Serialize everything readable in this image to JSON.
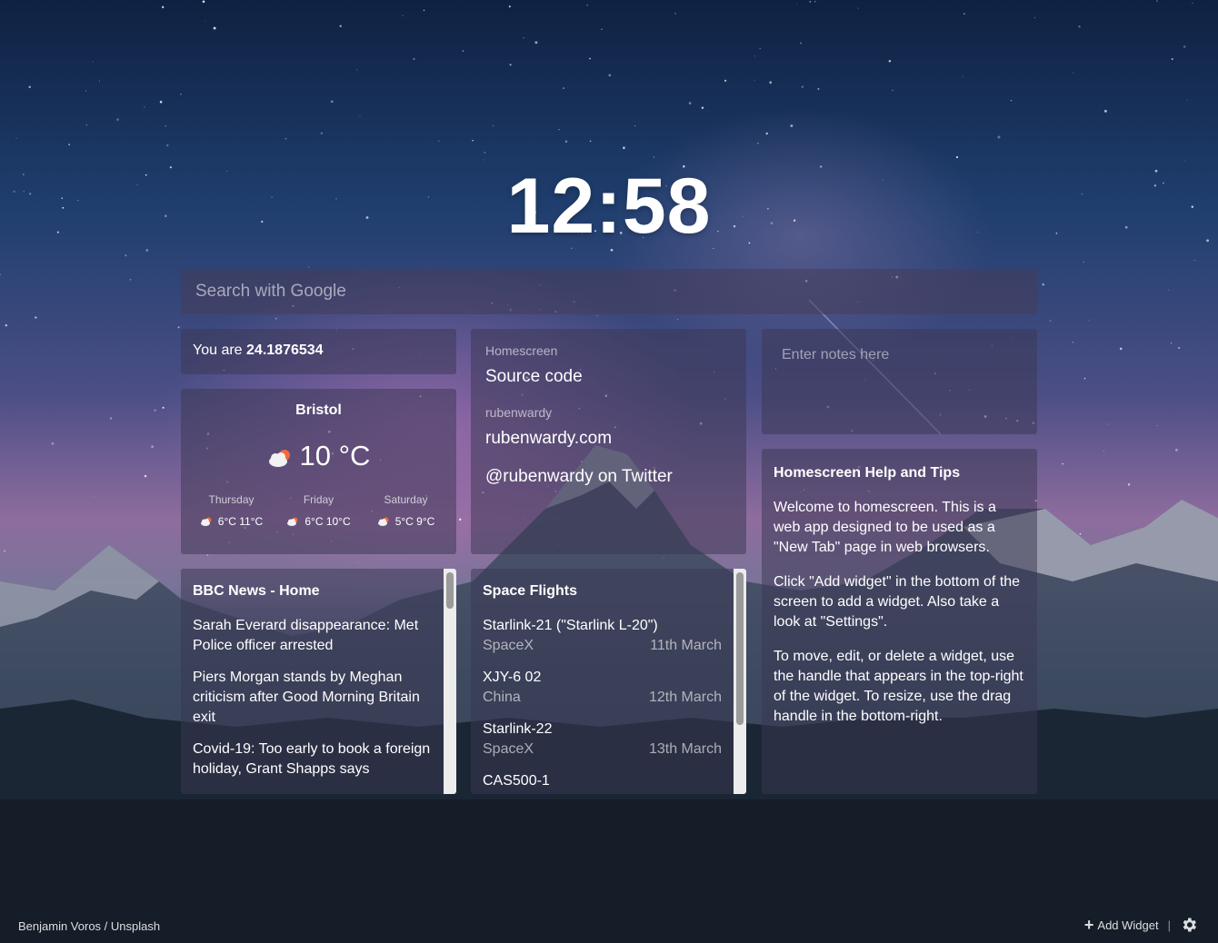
{
  "clock": {
    "time": "12:58"
  },
  "search": {
    "placeholder": "Search with Google"
  },
  "location": {
    "prefix": "You are",
    "value": "24.1876534"
  },
  "weather": {
    "city": "Bristol",
    "current_temp": "10 °C",
    "current_icon": "partly-cloudy-icon",
    "forecast": [
      {
        "day": "Thursday",
        "temps": "6°C 11°C",
        "icon": "partly-cloudy-icon"
      },
      {
        "day": "Friday",
        "temps": "6°C 10°C",
        "icon": "partly-cloudy-icon"
      },
      {
        "day": "Saturday",
        "temps": "5°C 9°C",
        "icon": "partly-cloudy-icon"
      }
    ]
  },
  "links": {
    "groups": [
      {
        "heading": "Homescreen",
        "items": [
          "Source code"
        ]
      },
      {
        "heading": "rubenwardy",
        "items": [
          "rubenwardy.com",
          "@rubenwardy on Twitter"
        ]
      }
    ]
  },
  "notes": {
    "placeholder": "Enter notes here"
  },
  "help": {
    "title": "Homescreen Help and Tips",
    "paragraphs": [
      "Welcome to homescreen. This is a web app designed to be used as a \"New Tab\" page in web browsers.",
      "Click \"Add widget\" in the bottom of the screen to add a widget. Also take a look at \"Settings\".",
      "To move, edit, or delete a widget, use the handle that appears in the top-right of the widget. To resize, use the drag handle in the bottom-right."
    ]
  },
  "feed": {
    "title": "BBC News - Home",
    "items": [
      "Sarah Everard disappearance: Met Police officer arrested",
      "Piers Morgan stands by Meghan criticism after Good Morning Britain exit",
      "Covid-19: Too early to book a foreign holiday, Grant Shapps says"
    ]
  },
  "space": {
    "title": "Space Flights",
    "flights": [
      {
        "name": "Starlink-21 (\"Starlink L-20\")",
        "agency": "SpaceX",
        "date": "11th March"
      },
      {
        "name": "XJY-6 02",
        "agency": "China",
        "date": "12th March"
      },
      {
        "name": "Starlink-22",
        "agency": "SpaceX",
        "date": "13th March"
      },
      {
        "name": "CAS500-1",
        "agency": "",
        "date": ""
      }
    ]
  },
  "footer": {
    "credit": "Benjamin Voros / Unsplash",
    "add_widget": "Add Widget",
    "separator": "|",
    "settings_icon": "gear-icon"
  }
}
